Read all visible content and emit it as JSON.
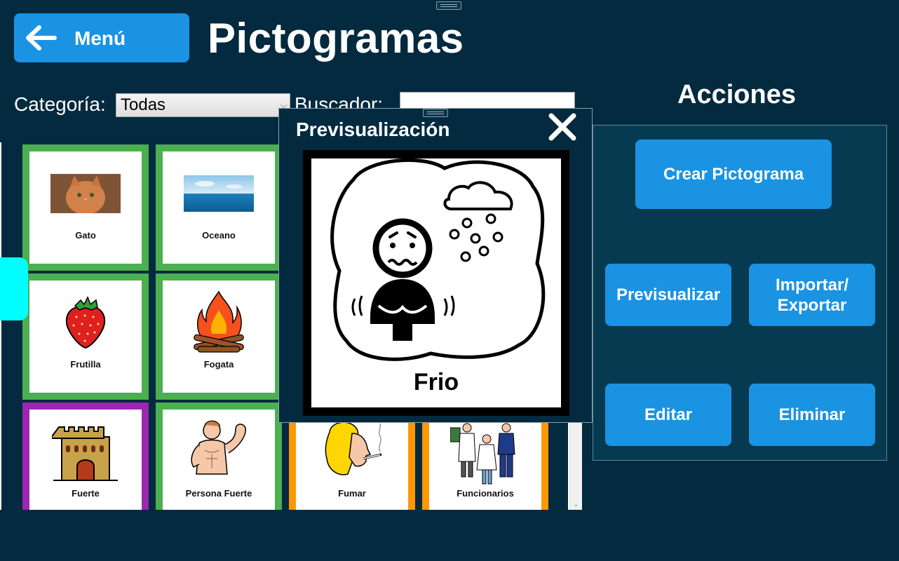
{
  "header": {
    "menu_label": "Menú",
    "page_title": "Pictogramas"
  },
  "filters": {
    "category_label": "Categoría:",
    "category_value": "Todas",
    "search_label": "Buscador:",
    "search_value": ""
  },
  "cards": [
    {
      "label": "Gato",
      "border": "#4caf50",
      "icon": "cat-photo"
    },
    {
      "label": "Oceano",
      "border": "#4caf50",
      "icon": "ocean-photo"
    },
    {
      "label": "Frutilla",
      "border": "#4caf50",
      "icon": "strawberry-icon"
    },
    {
      "label": "Fogata",
      "border": "#4caf50",
      "icon": "campfire-icon"
    },
    {
      "label": "Fuerte",
      "border": "#9c27b0",
      "icon": "fort-icon"
    },
    {
      "label": "Persona Fuerte",
      "border": "#4caf50",
      "icon": "strong-person-icon"
    },
    {
      "label": "Fumar",
      "border": "#ff9800",
      "icon": "smoking-icon"
    },
    {
      "label": "Funcionarios",
      "border": "#ff9800",
      "icon": "workers-icon"
    }
  ],
  "preview": {
    "title": "Previsualización",
    "word": "Frio"
  },
  "actions": {
    "title": "Acciones",
    "create": "Crear Pictograma",
    "preview": "Previsualizar",
    "import_export_line1": "Importar/",
    "import_export_line2": "Exportar",
    "edit": "Editar",
    "delete": "Eliminar"
  },
  "colors": {
    "background": "#032a3f",
    "accent": "#1a93e3",
    "side_tab": "#00ffff"
  }
}
